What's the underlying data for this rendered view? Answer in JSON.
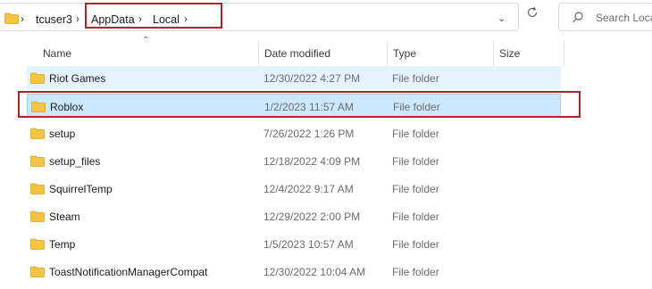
{
  "breadcrumb": {
    "items": [
      "tcuser3",
      "AppData",
      "Local"
    ]
  },
  "search": {
    "placeholder": "Search Loca"
  },
  "columns": {
    "name": "Name",
    "date": "Date modified",
    "type": "Type",
    "size": "Size"
  },
  "rows": [
    {
      "name": "Riot Games",
      "date": "12/30/2022 4:27 PM",
      "type": "File folder",
      "state": "hover"
    },
    {
      "name": "Roblox",
      "date": "1/2/2023 11:57 AM",
      "type": "File folder",
      "state": "selected"
    },
    {
      "name": "setup",
      "date": "7/26/2022 1:26 PM",
      "type": "File folder",
      "state": "normal"
    },
    {
      "name": "setup_files",
      "date": "12/18/2022 4:09 PM",
      "type": "File folder",
      "state": "normal"
    },
    {
      "name": "SquirrelTemp",
      "date": "12/4/2022 9:17 AM",
      "type": "File folder",
      "state": "normal"
    },
    {
      "name": "Steam",
      "date": "12/29/2022 2:00 PM",
      "type": "File folder",
      "state": "normal"
    },
    {
      "name": "Temp",
      "date": "1/5/2023 10:57 AM",
      "type": "File folder",
      "state": "normal"
    },
    {
      "name": "ToastNotificationManagerCompat",
      "date": "12/30/2022 10:04 AM",
      "type": "File folder",
      "state": "normal"
    }
  ],
  "colors": {
    "highlight_box": "#b3202a",
    "row_hover": "#e5f3ff",
    "row_selected": "#cce8ff",
    "folder": "#f5c542"
  },
  "icons": [
    "folder-icon",
    "chevron-right-icon",
    "chevron-down-icon",
    "refresh-icon",
    "search-icon",
    "sort-up-icon"
  ]
}
